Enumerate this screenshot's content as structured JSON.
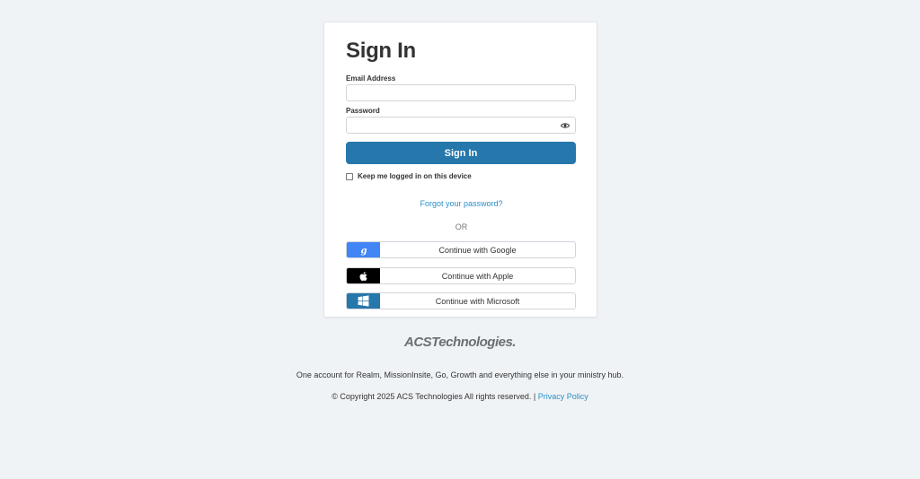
{
  "signin": {
    "title": "Sign In",
    "email_label": "Email Address",
    "email_value": "",
    "password_label": "Password",
    "password_value": "",
    "submit_label": "Sign In",
    "keep_logged_in_label": "Keep me logged in on this device",
    "forgot_label": "Forgot your password?",
    "or_label": "OR"
  },
  "social": {
    "google_label": "Continue with Google",
    "apple_label": "Continue with Apple",
    "microsoft_label": "Continue with Microsoft"
  },
  "footer": {
    "logo_text": "ACSTechnologies.",
    "tagline": "One account for Realm, MissionInsite, Go, Growth and everything else in your ministry hub.",
    "copyright": "© Copyright 2025 ACS Technologies All rights reserved. |",
    "privacy_label": "Privacy Policy"
  },
  "colors": {
    "primary": "#2677ab",
    "link": "#2a8fc9",
    "google": "#4285f4",
    "apple": "#000000",
    "microsoft": "#2677ab",
    "background": "#f0f3f6"
  }
}
